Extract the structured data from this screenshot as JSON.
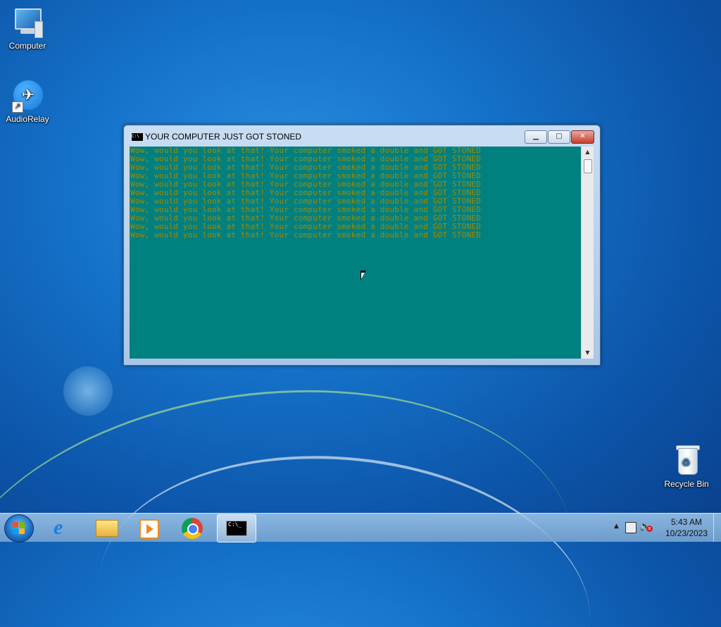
{
  "desktop": {
    "icons": [
      {
        "label": "Computer"
      },
      {
        "label": "AudioRelay"
      },
      {
        "label": "Recycle Bin"
      }
    ]
  },
  "window": {
    "title": "YOUR COMPUTER JUST GOT STONED",
    "title_icon": "C:\\",
    "controls": {
      "minimize": "▁",
      "maximize": "□",
      "close": "✕"
    },
    "console_bg": "#018080",
    "console_fg": "#a08a00",
    "lines": [
      "Wow, would you look at that! Your computer smoked a double and GOT STONED",
      "Wow, would you look at that! Your computer smoked a double and GOT STONED",
      "Wow, would you look at that! Your computer smoked a double and GOT STONED",
      "Wow, would you look at that! Your computer smoked a double and GOT STONED",
      "Wow, would you look at that! Your computer smoked a double and GOT STONED",
      "Wow, would you look at that! Your computer smoked a double and GOT STONED",
      "Wow, would you look at that! Your computer smoked a double and GOT STONED",
      "Wow, would you look at that! Your computer smoked a double and GOT STONED",
      "Wow, would you look at that! Your computer smoked a double and GOT STONED",
      "Wow, would you look at that! Your computer smoked a double and GOT STONED",
      "Wow, would you look at that! Your computer smoked a double and GOT STONED"
    ]
  },
  "taskbar": {
    "cmd_icon_text": "C:\\_",
    "clock": {
      "time": "5:43 AM",
      "date": "10/23/2023"
    }
  }
}
